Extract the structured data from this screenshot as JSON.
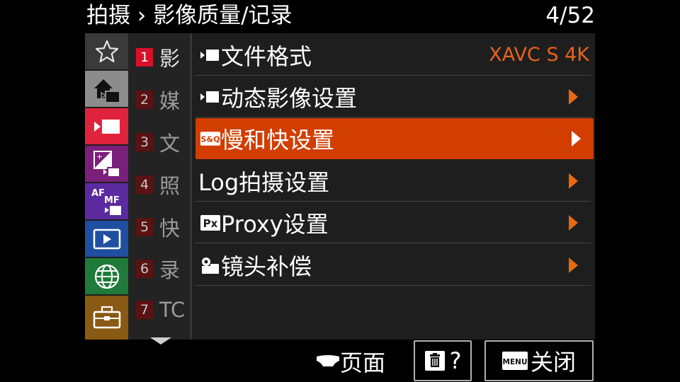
{
  "header": {
    "breadcrumb": "拍摄 › 影像质量/记录",
    "page": "4/52"
  },
  "categories": [
    {
      "icon": "star-icon",
      "color": "#5a5a5a"
    },
    {
      "icon": "camera-home-icon",
      "color": "#8c8c8c"
    },
    {
      "icon": "movie-camera-icon",
      "color": "#e0233c"
    },
    {
      "icon": "exposure-color-icon",
      "color": "#7a1f7a"
    },
    {
      "icon": "af-mf-icon",
      "color": "#5b2aa0"
    },
    {
      "icon": "playback-icon",
      "color": "#1f4fa0"
    },
    {
      "icon": "globe-network-icon",
      "color": "#207a3a"
    },
    {
      "icon": "toolbox-icon",
      "color": "#8a5a14"
    }
  ],
  "submenu": [
    {
      "num": "1",
      "label": "影"
    },
    {
      "num": "2",
      "label": "媒"
    },
    {
      "num": "3",
      "label": "文"
    },
    {
      "num": "4",
      "label": "照"
    },
    {
      "num": "5",
      "label": "快"
    },
    {
      "num": "6",
      "label": "录"
    },
    {
      "num": "7",
      "label": "TC"
    }
  ],
  "items": [
    {
      "label": "文件格式",
      "value": "XAVC S 4K",
      "icon": "movie-icon"
    },
    {
      "label": "动态影像设置",
      "icon": "movie-icon"
    },
    {
      "label": "慢和快设置",
      "icon": "sq-icon",
      "icon_text": "S&Q"
    },
    {
      "label": "Log拍摄设置"
    },
    {
      "label": "Proxy设置",
      "icon": "proxy-icon",
      "icon_text": "Px"
    },
    {
      "label": "镜头补偿",
      "icon": "lens-icon"
    }
  ],
  "footer": {
    "page_label": "页面",
    "delete_help": "?",
    "menu_key": "MENU",
    "close_label": "关闭"
  },
  "colors": {
    "accent": "#d23d00",
    "arrow": "#e86a10",
    "value": "#e8621a"
  }
}
